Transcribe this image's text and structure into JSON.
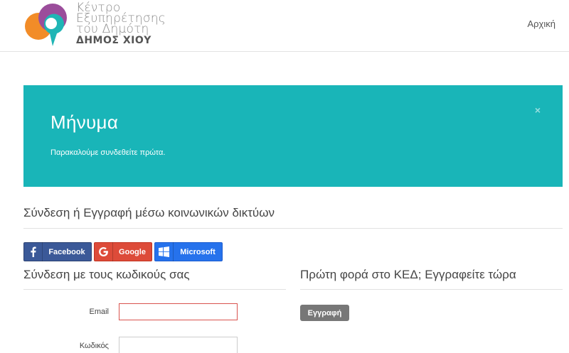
{
  "header": {
    "logo_lines": [
      "Κέντρο",
      "Εξυπηρέτησης",
      "του Δημότη",
      "ΔΗΜΟΣ ΧΙΟΥ"
    ],
    "nav_home": "Αρχική"
  },
  "alert": {
    "title": "Μήνυμα",
    "text": "Παρακαλούμε συνδεθείτε πρώτα.",
    "close": "×",
    "color": "#19b5b8"
  },
  "social": {
    "title": "Σύνδεση ή Εγγραφή μέσω κοινωνικών δικτύων",
    "buttons": [
      {
        "label": "Facebook",
        "icon": "facebook-icon",
        "color": "#3b5998"
      },
      {
        "label": "Google",
        "icon": "google-icon",
        "color": "#dd4b39"
      },
      {
        "label": "Microsoft",
        "icon": "windows-icon",
        "color": "#2672ec"
      }
    ]
  },
  "login": {
    "title": "Σύνδεση με τους κωδικούς σας",
    "email_label": "Email",
    "email_value": "",
    "password_label": "Κωδικός",
    "password_value": ""
  },
  "register": {
    "title": "Πρώτη φορά στο ΚΕΔ; Εγγραφείτε τώρα",
    "button": "Εγγραφή"
  }
}
